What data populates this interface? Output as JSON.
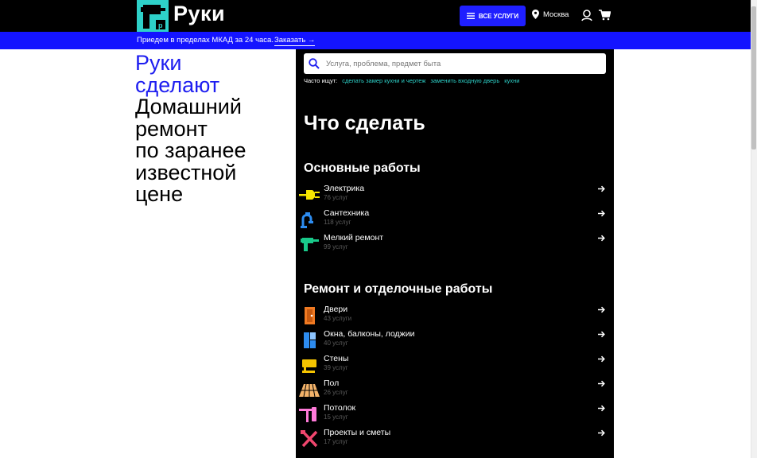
{
  "header": {
    "logo_text": "Руки",
    "all_services_label": "ВСЕ УСЛУГИ",
    "city": "Москва"
  },
  "banner": {
    "text": "Приедем в пределах МКАД за 24 часа.",
    "link": "Заказать →"
  },
  "hero": {
    "line1": "Руки",
    "line2": "сделают",
    "line3": "Домашний",
    "line4": "ремонт",
    "line5": "по заранее",
    "line6": "известной",
    "line7": "цене"
  },
  "search": {
    "placeholder": "Услуга, проблема, предмет быта",
    "often_label": "Часто ищут:",
    "often_links": [
      "сделать замер кухни и чертеж",
      "заменить входную дверь",
      "кухни"
    ]
  },
  "panel": {
    "title": "Что сделать",
    "sections": [
      {
        "title": "Основные работы",
        "items": [
          {
            "name": "Электрика",
            "count": "76 услуг",
            "icon": "plug-icon"
          },
          {
            "name": "Сантехника",
            "count": "118 услуг",
            "icon": "faucet-icon"
          },
          {
            "name": "Мелкий ремонт",
            "count": "99 услуг",
            "icon": "drill-icon"
          }
        ]
      },
      {
        "title": "Ремонт и отделочные работы",
        "items": [
          {
            "name": "Двери",
            "count": "43 услуги",
            "icon": "door-icon"
          },
          {
            "name": "Окна, балконы, лоджии",
            "count": "40 услуг",
            "icon": "window-icon"
          },
          {
            "name": "Стены",
            "count": "39 услуг",
            "icon": "wall-roller-icon"
          },
          {
            "name": "Пол",
            "count": "26 услуг",
            "icon": "floor-icon"
          },
          {
            "name": "Потолок",
            "count": "15 услуг",
            "icon": "ceiling-roller-icon"
          },
          {
            "name": "Проекты и сметы",
            "count": "17 услуг",
            "icon": "tools-icon"
          }
        ]
      }
    ]
  },
  "colors": {
    "brand_blue": "#1e1ef0",
    "teal": "#2ed1c9"
  }
}
